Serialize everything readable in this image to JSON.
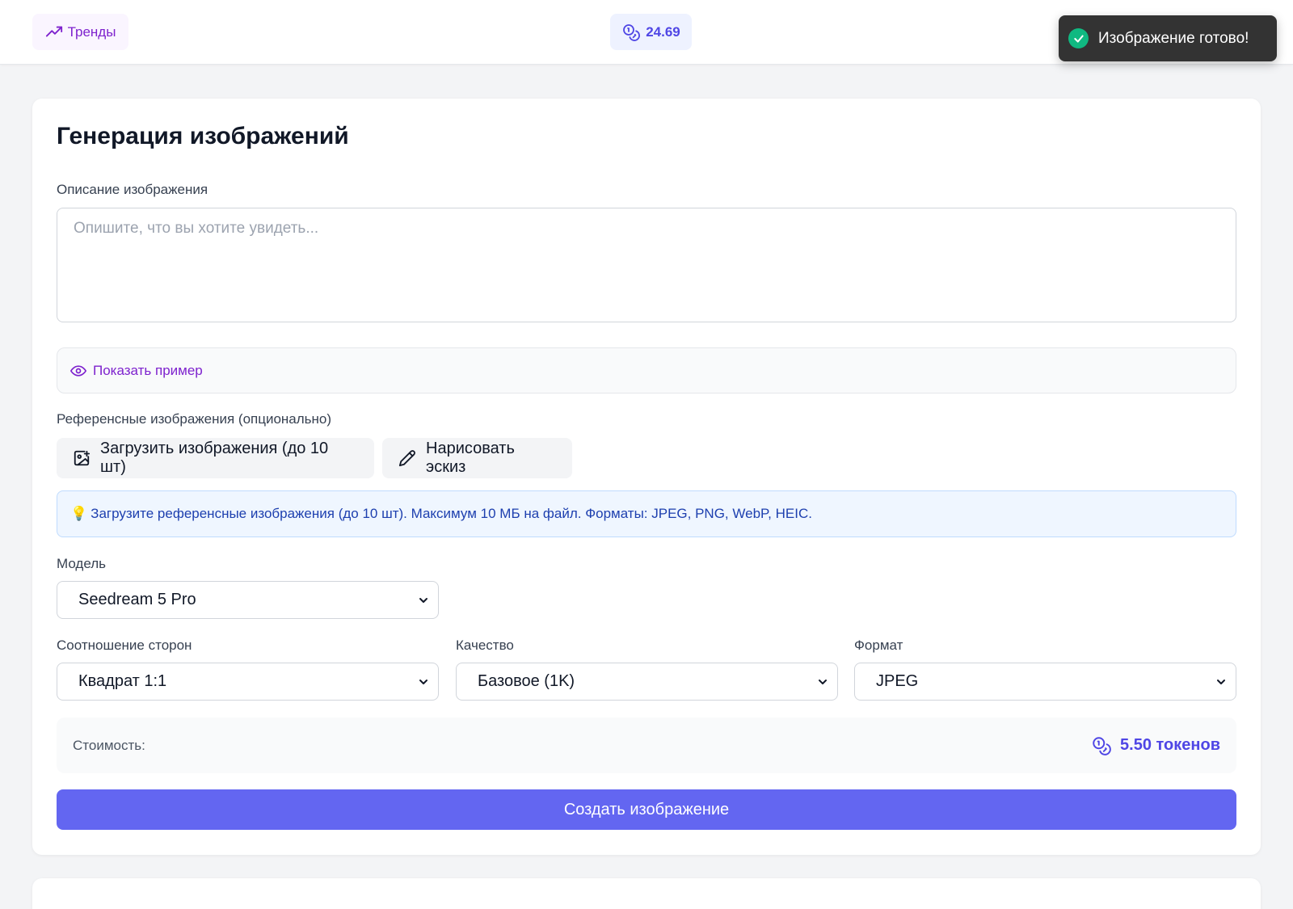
{
  "header": {
    "trends_label": "Тренды",
    "balance": "24.69"
  },
  "toast": {
    "message": "Изображение готово!"
  },
  "form": {
    "title": "Генерация изображений",
    "description_label": "Описание изображения",
    "description_value": "",
    "description_placeholder": "Опишите, что вы хотите увидеть...",
    "show_example_label": "Показать пример",
    "reference_label": "Референсные изображения (опционально)",
    "upload_button": "Загрузить изображения (до 10 шт)",
    "sketch_button": "Нарисовать эскиз",
    "info_emoji": "💡",
    "info_text": "Загрузите референсные изображения (до 10 шт). Максимум 10 МБ на файл. Форматы: JPEG, PNG, WebP, HEIC.",
    "model_label": "Модель",
    "model_value": "Seedream 5 Pro",
    "aspect_label": "Соотношение сторон",
    "aspect_value": "Квадрат 1:1",
    "quality_label": "Качество",
    "quality_value": "Базовое (1K)",
    "format_label": "Формат",
    "format_value": "JPEG",
    "cost_label": "Стоимость:",
    "cost_value": "5.50 токенов",
    "submit_label": "Создать изображение"
  },
  "colors": {
    "accent": "#6366f1",
    "purple_text": "#7e22ce",
    "success": "#10b981"
  },
  "icons": {
    "trends": "trending-up-icon",
    "tokens": "coins-icon",
    "toast": "check-circle-icon",
    "example": "eye-icon",
    "upload": "image-plus-icon",
    "sketch": "pencil-icon",
    "select": "chevron-down-icon"
  }
}
